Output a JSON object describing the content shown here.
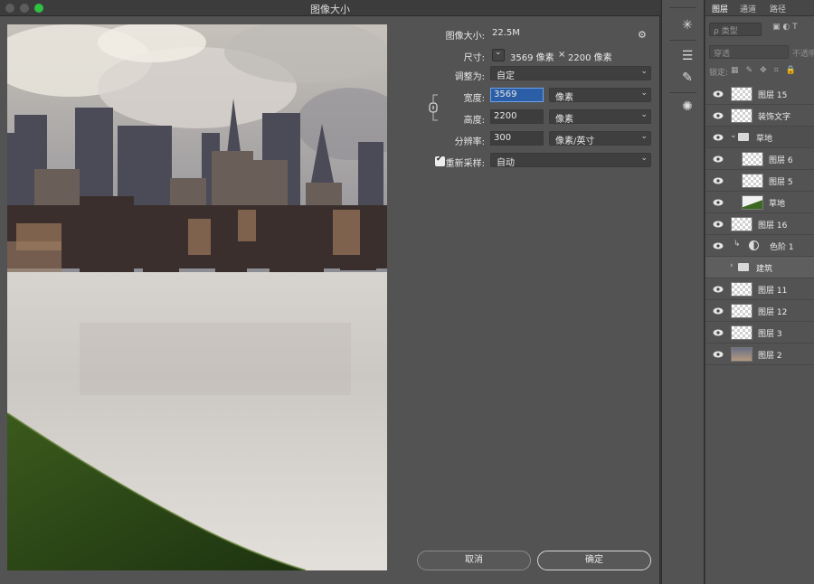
{
  "dialog": {
    "title": "图像大小",
    "image_size_label": "图像大小:",
    "image_size_value": "22.5M",
    "dimensions_label": "尺寸:",
    "dimensions_width": "3569 像素",
    "dimensions_x": "×",
    "dimensions_height": "2200 像素",
    "fit_label": "调整为:",
    "fit_value": "自定",
    "width_label": "宽度:",
    "width_value": "3569",
    "width_unit": "像素",
    "height_label": "高度:",
    "height_value": "2200",
    "height_unit": "像素",
    "resolution_label": "分辨率:",
    "resolution_value": "300",
    "resolution_unit": "像素/英寸",
    "resample_label": "重新采样:",
    "resample_checked": true,
    "resample_value": "自动",
    "cancel_label": "取消",
    "ok_label": "确定"
  },
  "layers_panel": {
    "tabs": [
      "图层",
      "通道",
      "路径"
    ],
    "filter_placeholder": "ρ 类型",
    "blend_mode": "穿透",
    "opacity_label": "不透明",
    "lock_label": "锁定:",
    "layers": [
      {
        "name": "图层 15",
        "type": "layer",
        "indent": 0
      },
      {
        "name": "装饰文字",
        "type": "layer",
        "indent": 0
      },
      {
        "name": "草地",
        "type": "group-open",
        "indent": 0
      },
      {
        "name": "图层 6",
        "type": "layer",
        "indent": 1
      },
      {
        "name": "图层 5",
        "type": "layer",
        "indent": 1
      },
      {
        "name": "草地",
        "type": "layer-grass",
        "indent": 1
      },
      {
        "name": "图层 16",
        "type": "layer",
        "indent": 0
      },
      {
        "name": "色阶 1",
        "type": "adjustment",
        "indent": 0
      },
      {
        "name": "建筑",
        "type": "group-closed",
        "indent": 0
      },
      {
        "name": "图层 11",
        "type": "layer",
        "indent": 0
      },
      {
        "name": "图层 12",
        "type": "layer",
        "indent": 0
      },
      {
        "name": "图层 3",
        "type": "layer",
        "indent": 0
      },
      {
        "name": "图层 2",
        "type": "layer-photo",
        "indent": 0
      }
    ]
  }
}
